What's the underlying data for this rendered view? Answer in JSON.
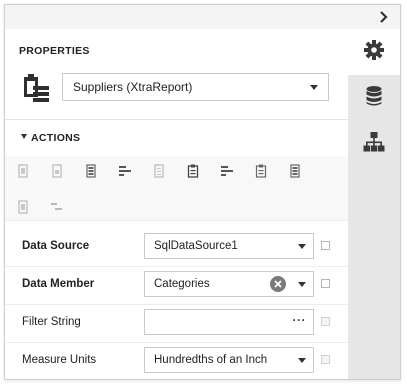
{
  "panel": {
    "title": "PROPERTIES",
    "report": {
      "selected": "Suppliers (XtraReport)",
      "icon": "report-clipboard-icon"
    },
    "tabs": [
      {
        "name": "properties-tab",
        "icon": "gear-icon",
        "active": true
      },
      {
        "name": "field-list-tab",
        "icon": "database-icon",
        "active": false
      },
      {
        "name": "report-explorer-tab",
        "icon": "hierarchy-icon",
        "active": false
      }
    ]
  },
  "actions": {
    "title": "ACTIONS",
    "expanded": true,
    "items": [
      "insert-detail-icon",
      "insert-group-icon",
      "insert-band-icon",
      "align-left-icon",
      "document-icon",
      "edit-report-icon",
      "align-icon",
      "clipboard-icon",
      "band-icon",
      "layout-icon",
      "sub-band-icon"
    ]
  },
  "properties": [
    {
      "label": "Data Source",
      "bold": true,
      "value": "SqlDataSource1",
      "control": "dropdown",
      "checkbox_enabled": true
    },
    {
      "label": "Data Member",
      "bold": true,
      "value": "Categories",
      "control": "dropdown-clear",
      "checkbox_enabled": true
    },
    {
      "label": "Filter String",
      "bold": false,
      "value": "",
      "control": "ellipsis",
      "ellipsis_label": "···",
      "checkbox_enabled": false
    },
    {
      "label": "Measure Units",
      "bold": false,
      "value": "Hundredths of an Inch",
      "control": "dropdown",
      "checkbox_enabled": false
    }
  ],
  "colors": {
    "sidebar_bg": "#e6e6e6",
    "icon_dark": "#3a3a3a",
    "icon_muted": "#b8b8b8"
  }
}
